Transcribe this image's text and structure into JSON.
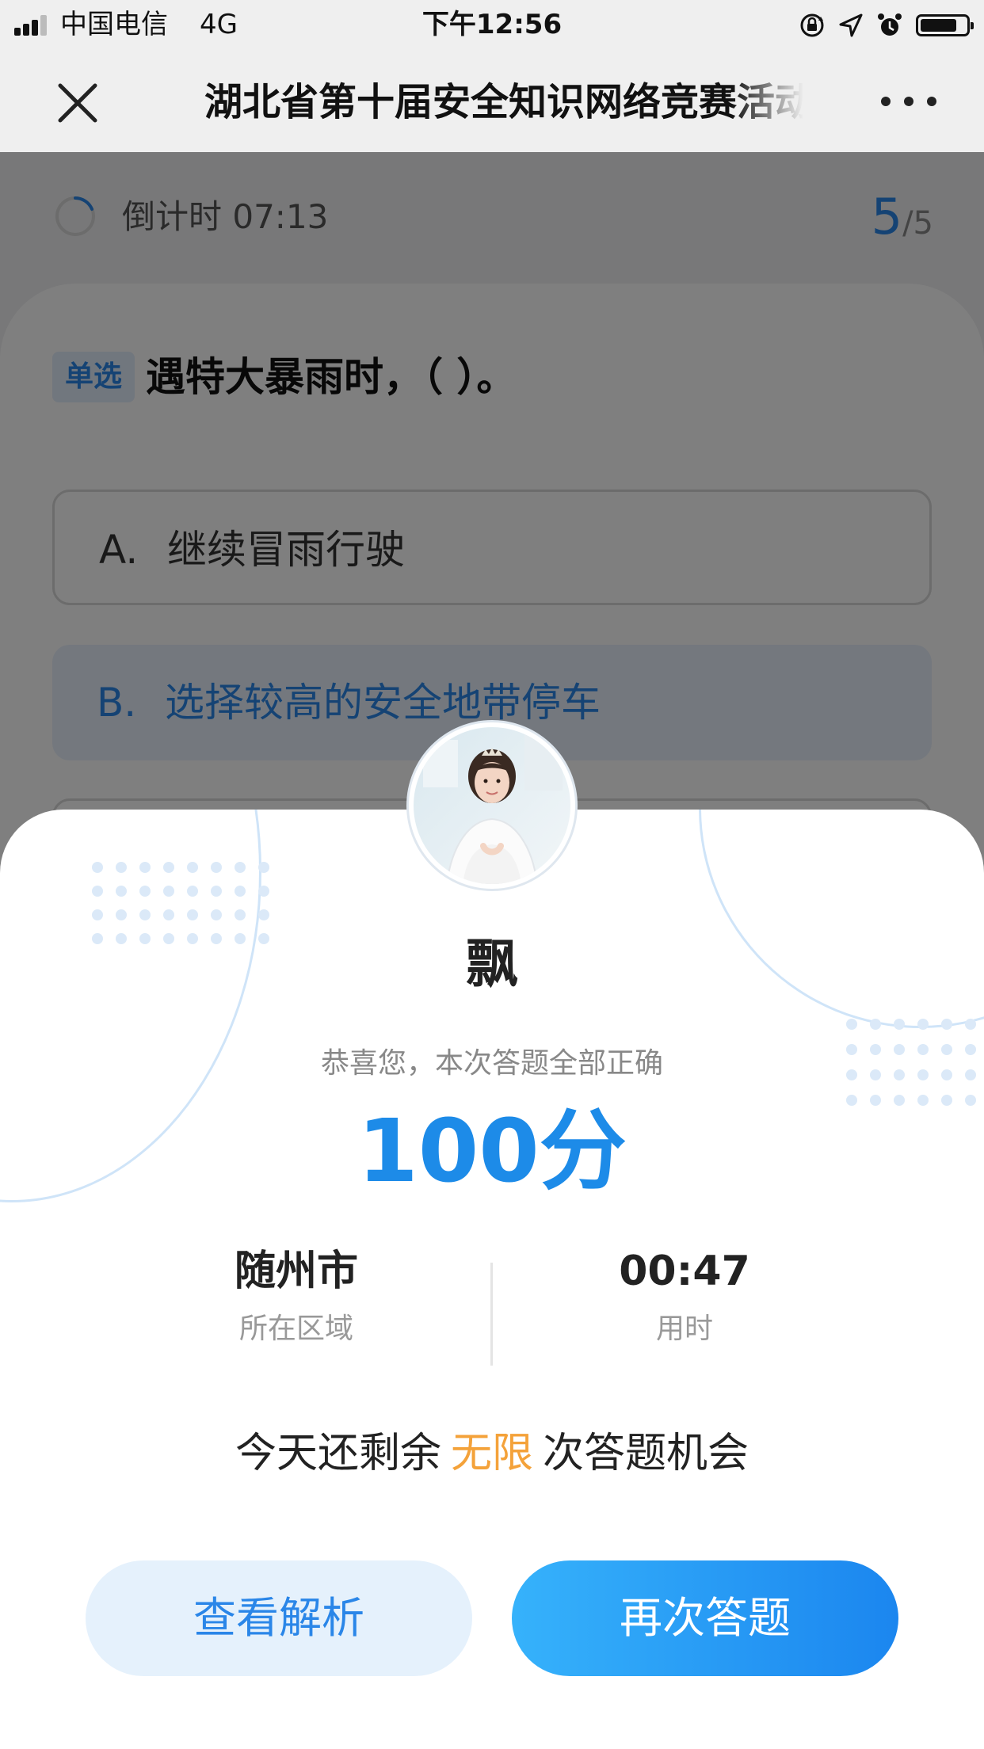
{
  "status_bar": {
    "carrier": "中国电信",
    "network": "4G",
    "time": "下午12:56"
  },
  "nav": {
    "title": "湖北省第十届安全知识网络竞赛活动"
  },
  "quiz": {
    "timer_label": "倒计时 07:13",
    "progress_current": "5",
    "progress_total": "/5",
    "question_type": "单选",
    "question_text": "遇特大暴雨时，（ ）。",
    "options": [
      {
        "letter": "A.",
        "text": "继续冒雨行驶"
      },
      {
        "letter": "B.",
        "text": "选择较高的安全地带停车"
      }
    ]
  },
  "result": {
    "username": "飘",
    "congrats": "恭喜您，本次答题全部正确",
    "score": "100分",
    "region_value": "随州市",
    "region_label": "所在区域",
    "time_value": "00:47",
    "time_label": "用时",
    "chances_prefix": "今天还剩余",
    "chances_value": "无限",
    "chances_suffix": "次答题机会",
    "review_button": "查看解析",
    "retry_button": "再次答题"
  },
  "colors": {
    "accent": "#1d8be8",
    "highlight": "#f4a23a",
    "button_gradient_start": "#36b2fb",
    "button_gradient_end": "#1b86ef"
  },
  "icons": {
    "close": "close-icon",
    "more": "more-icon",
    "timer": "timer-spinner-icon",
    "lock": "rotation-lock-icon",
    "location": "location-arrow-icon",
    "alarm": "alarm-clock-icon",
    "battery": "battery-icon"
  }
}
